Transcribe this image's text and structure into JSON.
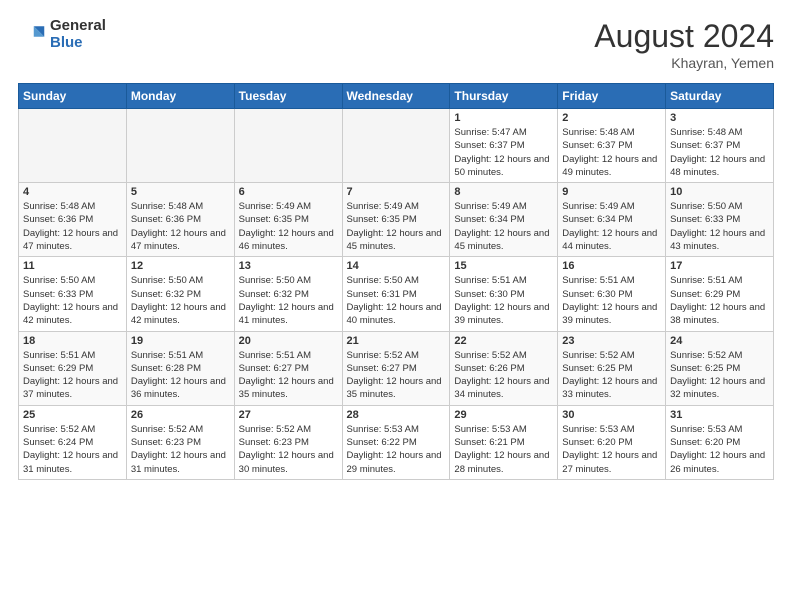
{
  "header": {
    "logo_general": "General",
    "logo_blue": "Blue",
    "month_title": "August 2024",
    "location": "Khayran, Yemen"
  },
  "days_of_week": [
    "Sunday",
    "Monday",
    "Tuesday",
    "Wednesday",
    "Thursday",
    "Friday",
    "Saturday"
  ],
  "weeks": [
    [
      {
        "day": "",
        "empty": true
      },
      {
        "day": "",
        "empty": true
      },
      {
        "day": "",
        "empty": true
      },
      {
        "day": "",
        "empty": true
      },
      {
        "day": "1",
        "sunrise": "5:47 AM",
        "sunset": "6:37 PM",
        "daylight": "12 hours and 50 minutes."
      },
      {
        "day": "2",
        "sunrise": "5:48 AM",
        "sunset": "6:37 PM",
        "daylight": "12 hours and 49 minutes."
      },
      {
        "day": "3",
        "sunrise": "5:48 AM",
        "sunset": "6:37 PM",
        "daylight": "12 hours and 48 minutes."
      }
    ],
    [
      {
        "day": "4",
        "sunrise": "5:48 AM",
        "sunset": "6:36 PM",
        "daylight": "12 hours and 47 minutes."
      },
      {
        "day": "5",
        "sunrise": "5:48 AM",
        "sunset": "6:36 PM",
        "daylight": "12 hours and 47 minutes."
      },
      {
        "day": "6",
        "sunrise": "5:49 AM",
        "sunset": "6:35 PM",
        "daylight": "12 hours and 46 minutes."
      },
      {
        "day": "7",
        "sunrise": "5:49 AM",
        "sunset": "6:35 PM",
        "daylight": "12 hours and 45 minutes."
      },
      {
        "day": "8",
        "sunrise": "5:49 AM",
        "sunset": "6:34 PM",
        "daylight": "12 hours and 45 minutes."
      },
      {
        "day": "9",
        "sunrise": "5:49 AM",
        "sunset": "6:34 PM",
        "daylight": "12 hours and 44 minutes."
      },
      {
        "day": "10",
        "sunrise": "5:50 AM",
        "sunset": "6:33 PM",
        "daylight": "12 hours and 43 minutes."
      }
    ],
    [
      {
        "day": "11",
        "sunrise": "5:50 AM",
        "sunset": "6:33 PM",
        "daylight": "12 hours and 42 minutes."
      },
      {
        "day": "12",
        "sunrise": "5:50 AM",
        "sunset": "6:32 PM",
        "daylight": "12 hours and 42 minutes."
      },
      {
        "day": "13",
        "sunrise": "5:50 AM",
        "sunset": "6:32 PM",
        "daylight": "12 hours and 41 minutes."
      },
      {
        "day": "14",
        "sunrise": "5:50 AM",
        "sunset": "6:31 PM",
        "daylight": "12 hours and 40 minutes."
      },
      {
        "day": "15",
        "sunrise": "5:51 AM",
        "sunset": "6:30 PM",
        "daylight": "12 hours and 39 minutes."
      },
      {
        "day": "16",
        "sunrise": "5:51 AM",
        "sunset": "6:30 PM",
        "daylight": "12 hours and 39 minutes."
      },
      {
        "day": "17",
        "sunrise": "5:51 AM",
        "sunset": "6:29 PM",
        "daylight": "12 hours and 38 minutes."
      }
    ],
    [
      {
        "day": "18",
        "sunrise": "5:51 AM",
        "sunset": "6:29 PM",
        "daylight": "12 hours and 37 minutes."
      },
      {
        "day": "19",
        "sunrise": "5:51 AM",
        "sunset": "6:28 PM",
        "daylight": "12 hours and 36 minutes."
      },
      {
        "day": "20",
        "sunrise": "5:51 AM",
        "sunset": "6:27 PM",
        "daylight": "12 hours and 35 minutes."
      },
      {
        "day": "21",
        "sunrise": "5:52 AM",
        "sunset": "6:27 PM",
        "daylight": "12 hours and 35 minutes."
      },
      {
        "day": "22",
        "sunrise": "5:52 AM",
        "sunset": "6:26 PM",
        "daylight": "12 hours and 34 minutes."
      },
      {
        "day": "23",
        "sunrise": "5:52 AM",
        "sunset": "6:25 PM",
        "daylight": "12 hours and 33 minutes."
      },
      {
        "day": "24",
        "sunrise": "5:52 AM",
        "sunset": "6:25 PM",
        "daylight": "12 hours and 32 minutes."
      }
    ],
    [
      {
        "day": "25",
        "sunrise": "5:52 AM",
        "sunset": "6:24 PM",
        "daylight": "12 hours and 31 minutes."
      },
      {
        "day": "26",
        "sunrise": "5:52 AM",
        "sunset": "6:23 PM",
        "daylight": "12 hours and 31 minutes."
      },
      {
        "day": "27",
        "sunrise": "5:52 AM",
        "sunset": "6:23 PM",
        "daylight": "12 hours and 30 minutes."
      },
      {
        "day": "28",
        "sunrise": "5:53 AM",
        "sunset": "6:22 PM",
        "daylight": "12 hours and 29 minutes."
      },
      {
        "day": "29",
        "sunrise": "5:53 AM",
        "sunset": "6:21 PM",
        "daylight": "12 hours and 28 minutes."
      },
      {
        "day": "30",
        "sunrise": "5:53 AM",
        "sunset": "6:20 PM",
        "daylight": "12 hours and 27 minutes."
      },
      {
        "day": "31",
        "sunrise": "5:53 AM",
        "sunset": "6:20 PM",
        "daylight": "12 hours and 26 minutes."
      }
    ]
  ],
  "labels": {
    "sunrise": "Sunrise:",
    "sunset": "Sunset:",
    "daylight": "Daylight:"
  }
}
